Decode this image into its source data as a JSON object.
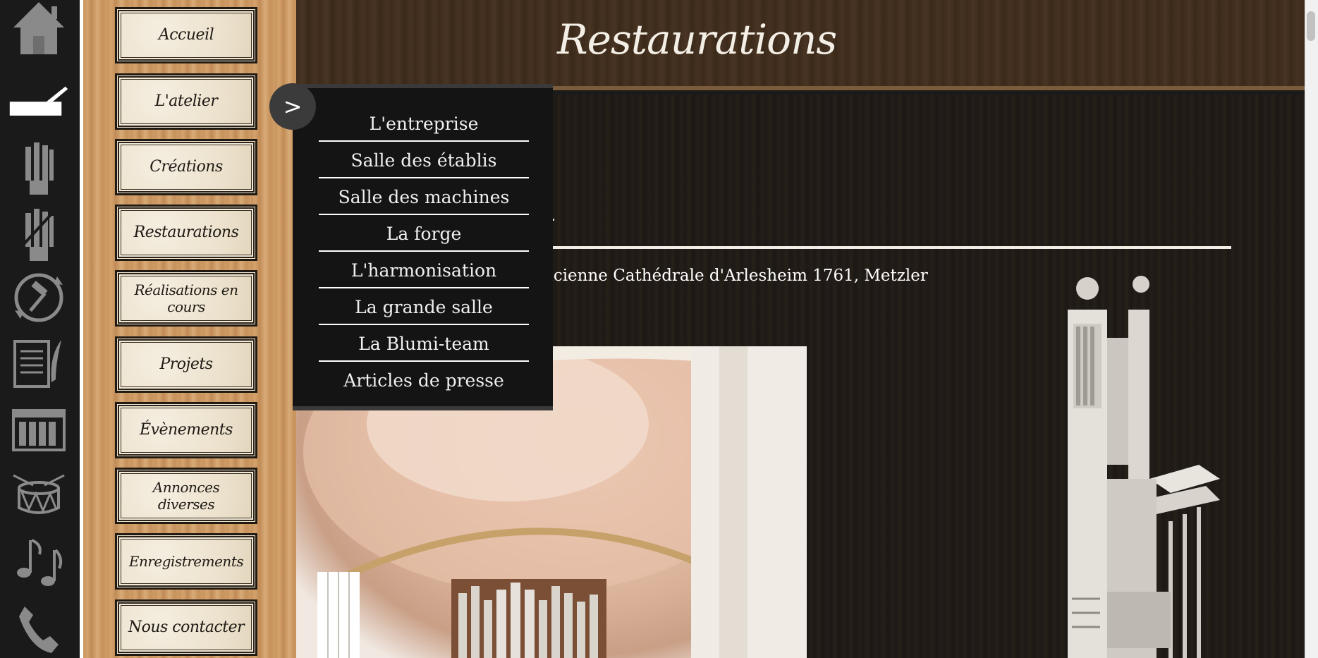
{
  "header": {
    "title": "Restaurations"
  },
  "sidebar_icons": [
    {
      "name": "home-icon"
    },
    {
      "name": "workbench-icon"
    },
    {
      "name": "organ-pipes-icon"
    },
    {
      "name": "organ-pipes-partial-icon"
    },
    {
      "name": "restoration-hammer-icon"
    },
    {
      "name": "document-feather-icon"
    },
    {
      "name": "calendar-icon"
    },
    {
      "name": "drum-icon"
    },
    {
      "name": "music-notes-icon"
    },
    {
      "name": "phone-icon"
    }
  ],
  "menu": {
    "items": [
      {
        "label": "Accueil"
      },
      {
        "label": "L'atelier"
      },
      {
        "label": "Créations"
      },
      {
        "label": "Restaurations"
      },
      {
        "label": "Réalisations en cours"
      },
      {
        "label": "Projets"
      },
      {
        "label": "Évènements"
      },
      {
        "label": "Annonces diverses"
      },
      {
        "label": "Enregistrements"
      },
      {
        "label": "Nous contacter"
      }
    ]
  },
  "submenu": {
    "toggle_label": ">",
    "items": [
      {
        "label": "L'entreprise"
      },
      {
        "label": "Salle des établis"
      },
      {
        "label": "Salle des machines"
      },
      {
        "label": "La forge"
      },
      {
        "label": "L'harmonisation"
      },
      {
        "label": "La grande salle"
      },
      {
        "label": "La Blumi-team"
      },
      {
        "label": "Articles de presse"
      }
    ]
  },
  "content": {
    "caption": "ncienne Cathédrale d'Arlesheim 1761, Metzler"
  }
}
